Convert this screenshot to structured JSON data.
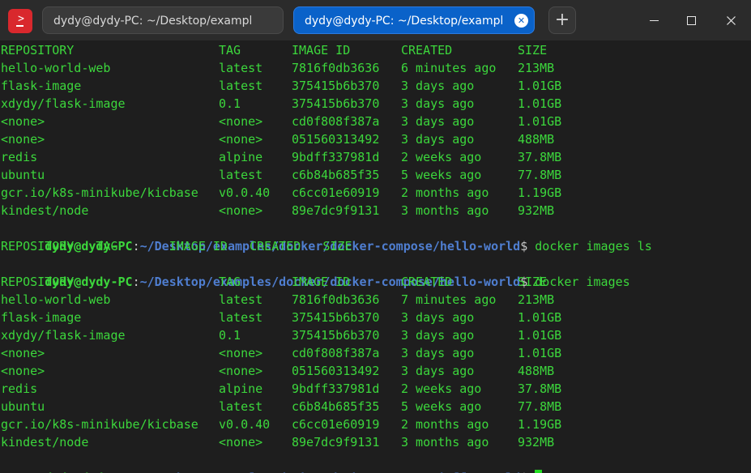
{
  "window": {
    "tabs": [
      {
        "label": "dydy@dydy-PC: ~/Desktop/examples/…",
        "active": false
      },
      {
        "label": "dydy@dydy-PC: ~/Desktop/examples/…",
        "active": true
      }
    ],
    "new_tab": "+",
    "controls": {
      "close": "✕"
    }
  },
  "colors": {
    "output_green": "#3cd73c",
    "path_blue": "#4f7ed0",
    "active_tab": "#0a62c9",
    "app_icon": "#d9282d"
  },
  "table1": {
    "headers": {
      "repo": "REPOSITORY",
      "tag": "TAG",
      "id": "IMAGE ID",
      "created": "CREATED",
      "size": "SIZE"
    },
    "rows": [
      {
        "repo": "hello-world-web",
        "tag": "latest",
        "id": "7816f0db3636",
        "created": "6 minutes ago",
        "size": "213MB"
      },
      {
        "repo": "flask-image",
        "tag": "latest",
        "id": "375415b6b370",
        "created": "3 days ago",
        "size": "1.01GB"
      },
      {
        "repo": "xdydy/flask-image",
        "tag": "0.1",
        "id": "375415b6b370",
        "created": "3 days ago",
        "size": "1.01GB"
      },
      {
        "repo": "<none>",
        "tag": "<none>",
        "id": "cd0f808f387a",
        "created": "3 days ago",
        "size": "1.01GB"
      },
      {
        "repo": "<none>",
        "tag": "<none>",
        "id": "051560313492",
        "created": "3 days ago",
        "size": "488MB"
      },
      {
        "repo": "redis",
        "tag": "alpine",
        "id": "9bdff337981d",
        "created": "2 weeks ago",
        "size": "37.8MB"
      },
      {
        "repo": "ubuntu",
        "tag": "latest",
        "id": "c6b84b685f35",
        "created": "5 weeks ago",
        "size": "77.8MB"
      },
      {
        "repo": "gcr.io/k8s-minikube/kicbase",
        "tag": "v0.0.40",
        "id": "c6cc01e60919",
        "created": "2 months ago",
        "size": "1.19GB"
      },
      {
        "repo": "kindest/node",
        "tag": "<none>",
        "id": "89e7dc9f9131",
        "created": "3 months ago",
        "size": "932MB"
      }
    ]
  },
  "prompt": {
    "user": "dydy@dydy-PC",
    "colon": ":",
    "path": "~/Desktop/examples/docker/docker-compose/hello-world",
    "dollar": "$"
  },
  "commands": {
    "first": "docker images ls",
    "second": "docker images"
  },
  "empty_listing": "REPOSITORY   TAG       IMAGE ID   CREATED   SIZE",
  "table2": {
    "headers": {
      "repo": "REPOSITORY",
      "tag": "TAG",
      "id": "IMAGE ID",
      "created": "CREATED",
      "size": "SIZE"
    },
    "rows": [
      {
        "repo": "hello-world-web",
        "tag": "latest",
        "id": "7816f0db3636",
        "created": "7 minutes ago",
        "size": "213MB"
      },
      {
        "repo": "flask-image",
        "tag": "latest",
        "id": "375415b6b370",
        "created": "3 days ago",
        "size": "1.01GB"
      },
      {
        "repo": "xdydy/flask-image",
        "tag": "0.1",
        "id": "375415b6b370",
        "created": "3 days ago",
        "size": "1.01GB"
      },
      {
        "repo": "<none>",
        "tag": "<none>",
        "id": "cd0f808f387a",
        "created": "3 days ago",
        "size": "1.01GB"
      },
      {
        "repo": "<none>",
        "tag": "<none>",
        "id": "051560313492",
        "created": "3 days ago",
        "size": "488MB"
      },
      {
        "repo": "redis",
        "tag": "alpine",
        "id": "9bdff337981d",
        "created": "2 weeks ago",
        "size": "37.8MB"
      },
      {
        "repo": "ubuntu",
        "tag": "latest",
        "id": "c6b84b685f35",
        "created": "5 weeks ago",
        "size": "77.8MB"
      },
      {
        "repo": "gcr.io/k8s-minikube/kicbase",
        "tag": "v0.0.40",
        "id": "c6cc01e60919",
        "created": "2 months ago",
        "size": "1.19GB"
      },
      {
        "repo": "kindest/node",
        "tag": "<none>",
        "id": "89e7dc9f9131",
        "created": "3 months ago",
        "size": "932MB"
      }
    ]
  }
}
